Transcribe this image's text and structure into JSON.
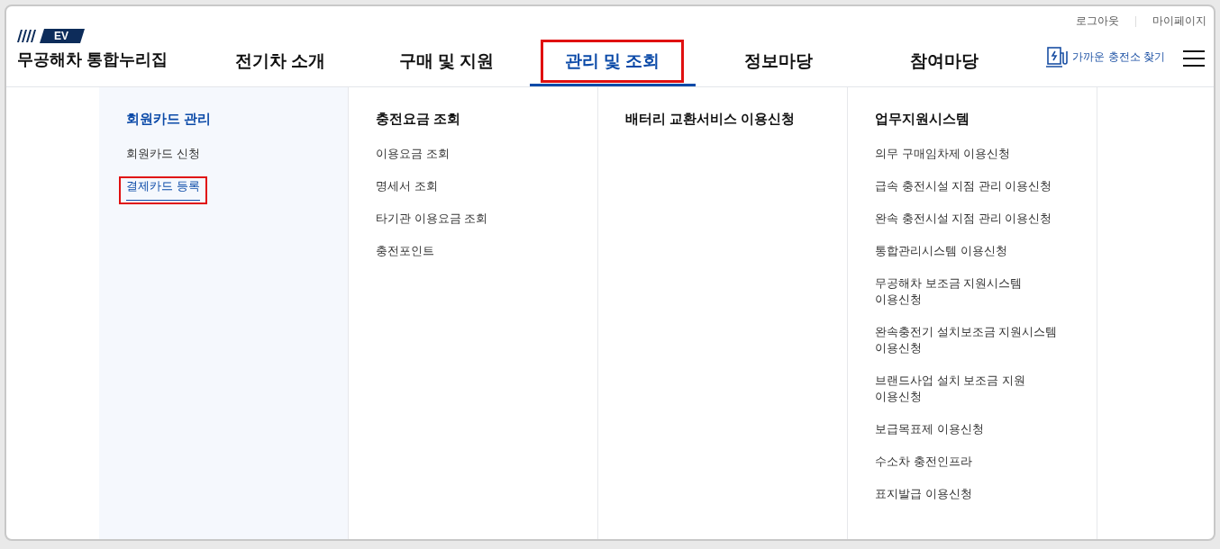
{
  "utility_links": [
    "로그아웃",
    "마이페이지"
  ],
  "logo": {
    "badge": "EV",
    "title": "무공해차 통합누리집"
  },
  "nav": [
    {
      "label": "전기차 소개",
      "selected": false,
      "highlighted": false
    },
    {
      "label": "구매 및 지원",
      "selected": false,
      "highlighted": false
    },
    {
      "label": "관리 및 조회",
      "selected": true,
      "highlighted": true
    },
    {
      "label": "정보마당",
      "selected": false,
      "highlighted": false
    },
    {
      "label": "참여마당",
      "selected": false,
      "highlighted": false
    }
  ],
  "station_search": "가까운 충전소 찾기",
  "menu_columns": [
    {
      "title": "회원카드 관리",
      "selected": true,
      "items": [
        {
          "label": "회원카드 신청",
          "selected": false,
          "highlighted": false
        },
        {
          "label": "결제카드 등록",
          "selected": true,
          "highlighted": true
        }
      ]
    },
    {
      "title": "충전요금 조회",
      "selected": false,
      "items": [
        {
          "label": "이용요금 조회",
          "selected": false,
          "highlighted": false
        },
        {
          "label": "명세서 조회",
          "selected": false,
          "highlighted": false
        },
        {
          "label": "타기관 이용요금 조회",
          "selected": false,
          "highlighted": false
        },
        {
          "label": "충전포인트",
          "selected": false,
          "highlighted": false
        }
      ]
    },
    {
      "title": "배터리 교환서비스 이용신청",
      "selected": false
    },
    {
      "title": "업무지원시스템",
      "selected": false,
      "items": [
        {
          "label": "의무 구매임차제 이용신청",
          "selected": false,
          "highlighted": false
        },
        {
          "label": "급속 충전시설 지점 관리 이용신청",
          "selected": false,
          "highlighted": false
        },
        {
          "label": "완속 충전시설 지점 관리 이용신청",
          "selected": false,
          "highlighted": false
        },
        {
          "label": "통합관리시스템 이용신청",
          "selected": false,
          "highlighted": false
        },
        {
          "label": "무공해차 보조금 지원시스템\n이용신청",
          "selected": false,
          "highlighted": false
        },
        {
          "label": "완속충전기 설치보조금 지원시스템\n이용신청",
          "selected": false,
          "highlighted": false
        },
        {
          "label": "브랜드사업 설치 보조금 지원\n이용신청",
          "selected": false,
          "highlighted": false
        },
        {
          "label": "보급목표제 이용신청",
          "selected": false,
          "highlighted": false
        },
        {
          "label": "수소차 충전인프라",
          "selected": false,
          "highlighted": false
        },
        {
          "label": "표지발급 이용신청",
          "selected": false,
          "highlighted": false
        }
      ]
    }
  ]
}
